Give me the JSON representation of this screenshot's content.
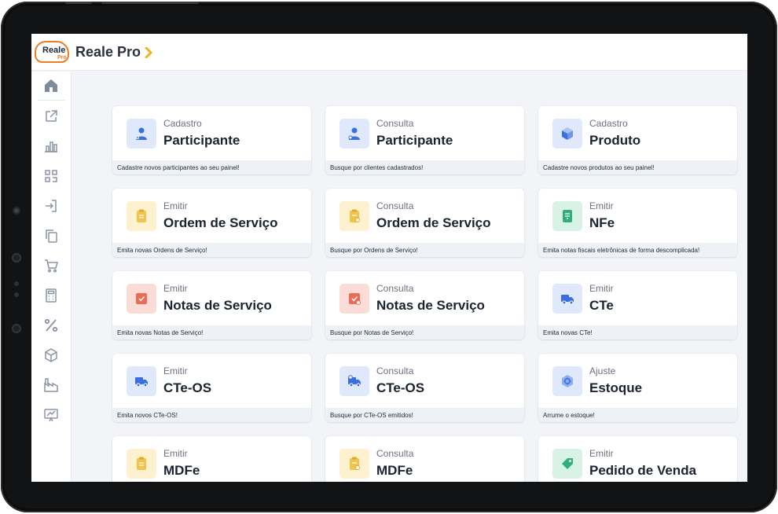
{
  "colors": {
    "brand_orange": "#f07b25",
    "screen_bg": "#f2f4f8",
    "icon_blue_bg": "#dfe9fb",
    "icon_blue": "#3b6fe0",
    "icon_yellow_bg": "#fdf1cf",
    "icon_yellow": "#f2c34a",
    "icon_red_bg": "#fbdcd6",
    "icon_red": "#ee6a55",
    "icon_green_bg": "#d8f3e6",
    "icon_green": "#2fae7a"
  },
  "header": {
    "logo_word": "Reale",
    "logo_sub": "Pro",
    "title": "Reale Pro",
    "title_icon": "chevron-right-icon"
  },
  "sidebar": {
    "items": [
      {
        "name": "home",
        "icon": "home-icon"
      },
      {
        "name": "edit",
        "icon": "edit-external-icon"
      },
      {
        "name": "reports",
        "icon": "bar-chart-icon"
      },
      {
        "name": "scan",
        "icon": "scan-icon"
      },
      {
        "name": "login",
        "icon": "login-icon"
      },
      {
        "name": "copy",
        "icon": "copy-icon"
      },
      {
        "name": "cart",
        "icon": "cart-icon"
      },
      {
        "name": "calculator",
        "icon": "calculator-icon"
      },
      {
        "name": "percent",
        "icon": "percent-icon"
      },
      {
        "name": "box",
        "icon": "box-icon"
      },
      {
        "name": "factory",
        "icon": "factory-icon"
      },
      {
        "name": "presentation",
        "icon": "presentation-chart-icon"
      }
    ]
  },
  "cards": [
    {
      "kind": "Cadastro",
      "title": "Participante",
      "desc": "Cadastre novos participantes ao seu painel!",
      "icon": "user-plus-icon",
      "tone": "blue"
    },
    {
      "kind": "Consulta",
      "title": "Participante",
      "desc": "Busque por clientes cadastrados!",
      "icon": "user-search-icon",
      "tone": "blue"
    },
    {
      "kind": "Cadastro",
      "title": "Produto",
      "desc": "Cadastre novos produtos ao seu painel!",
      "icon": "box-icon",
      "tone": "blue"
    },
    {
      "kind": "Emitir",
      "title": "Ordem de Serviço",
      "desc": "Emita novas Ordens de Serviço!",
      "icon": "clipboard-icon",
      "tone": "yellow"
    },
    {
      "kind": "Consulta",
      "title": "Ordem de Serviço",
      "desc": "Busque por Ordens de Serviço!",
      "icon": "clipboard-search-icon",
      "tone": "yellow"
    },
    {
      "kind": "Emitir",
      "title": "NFe",
      "desc": "Emita notas fiscais eletrônicas de forma descomplicada!",
      "icon": "receipt-icon",
      "tone": "green"
    },
    {
      "kind": "Emitir",
      "title": "Notas de Serviço",
      "desc": "Emita novas Notas de Serviço!",
      "icon": "note-check-icon",
      "tone": "red"
    },
    {
      "kind": "Consulta",
      "title": "Notas de Serviço",
      "desc": "Busque por Notas de Serviço!",
      "icon": "note-search-icon",
      "tone": "red"
    },
    {
      "kind": "Emitir",
      "title": "CTe",
      "desc": "Emita novas CTe!",
      "icon": "truck-icon",
      "tone": "blue"
    },
    {
      "kind": "Emitir",
      "title": "CTe-OS",
      "desc": "Emita novos CTe-OS!",
      "icon": "truck-icon",
      "tone": "blue"
    },
    {
      "kind": "Consulta",
      "title": "CTe-OS",
      "desc": "Busque por CTe-OS emitidos!",
      "icon": "truck-search-icon",
      "tone": "blue"
    },
    {
      "kind": "Ajuste",
      "title": "Estoque",
      "desc": "Arrume o estoque!",
      "icon": "stock-adjust-icon",
      "tone": "blue"
    },
    {
      "kind": "Emitir",
      "title": "MDFe",
      "desc": "",
      "icon": "clipboard-icon",
      "tone": "yellow"
    },
    {
      "kind": "Consulta",
      "title": "MDFe",
      "desc": "",
      "icon": "clipboard-search-icon",
      "tone": "yellow"
    },
    {
      "kind": "Emitir",
      "title": "Pedido de Venda",
      "desc": "",
      "icon": "tag-icon",
      "tone": "green"
    }
  ]
}
